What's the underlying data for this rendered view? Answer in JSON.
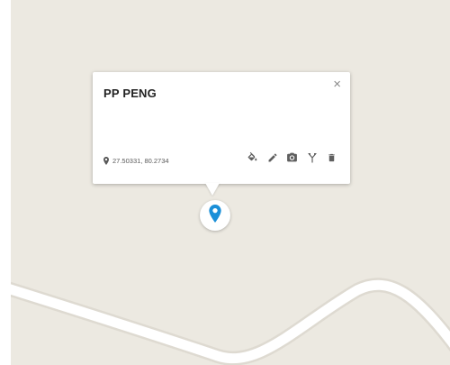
{
  "map": {
    "background_color": "#ece9e1",
    "road_color": "#ffffff",
    "road_casing_color": "#dedad1"
  },
  "popup": {
    "title": "PP PENG",
    "close_label": "×",
    "coordinates": "27.50331, 80.2734",
    "tools": [
      {
        "name": "fill-color-icon"
      },
      {
        "name": "pencil-icon"
      },
      {
        "name": "camera-icon"
      },
      {
        "name": "route-icon"
      },
      {
        "name": "trash-icon"
      }
    ]
  },
  "marker": {
    "color": "#1a8fd8",
    "icon": "location-pin-icon"
  }
}
